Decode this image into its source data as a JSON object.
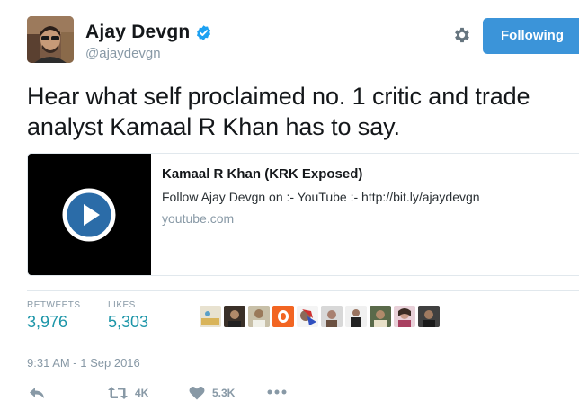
{
  "user": {
    "display_name": "Ajay Devgn",
    "handle": "@ajaydevgn",
    "verified": true
  },
  "header": {
    "follow_button_label": "Following"
  },
  "tweet": {
    "text": "Hear what self proclaimed no. 1 critic and trade analyst Kamaal R Khan has to say."
  },
  "card": {
    "title": "Kamaal R Khan (KRK Exposed)",
    "description": "Follow Ajay Devgn on :- YouTube :- http://bit.ly/ajaydevgn",
    "domain": "youtube.com"
  },
  "stats": {
    "retweets_label": "RETWEETS",
    "retweets_value": "3,976",
    "likes_label": "LIKES",
    "likes_value": "5,303"
  },
  "timestamp": "9:31 AM - 1 Sep 2016",
  "actions": {
    "retweet_count": "4K",
    "like_count": "5.3K"
  },
  "colors": {
    "follow_blue": "#3b94d9",
    "stat_teal": "#1b95a8",
    "muted_gray": "#8899a6",
    "verified_blue": "#1da1f2"
  }
}
